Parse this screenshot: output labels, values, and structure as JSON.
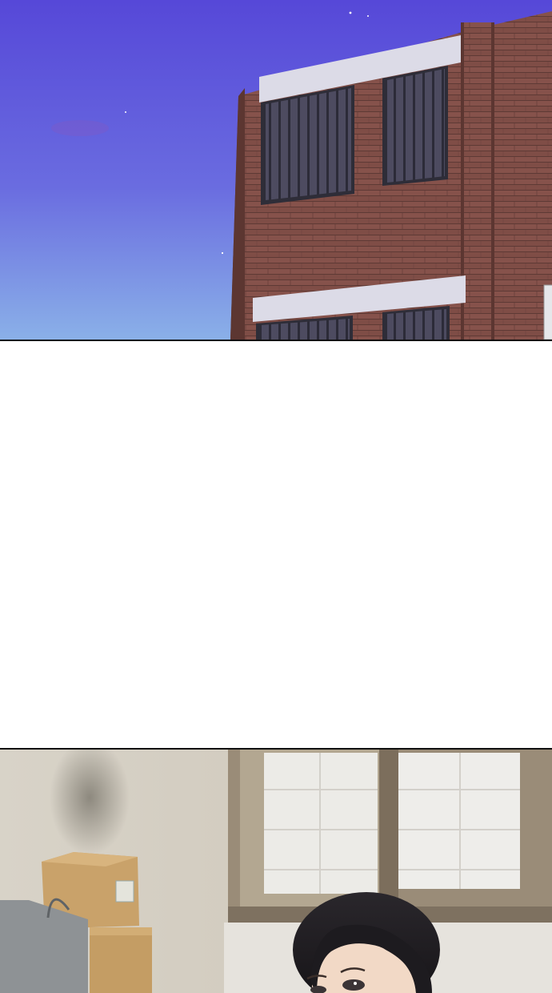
{
  "colors": {
    "sky_top": "#5a4fd6",
    "sky_mid": "#6a68e0",
    "sky_bottom": "#86a8e6",
    "brick": "#7a4a44",
    "brick_dark": "#5c3631",
    "window_glass": "#4a4a5c",
    "window_trim": "#d9d8e6",
    "interior_wall": "#ddd8cc",
    "interior_window_frame": "#8c7e6c",
    "box": "#c9a26a",
    "bag": "#8f9396",
    "hair": "#1d1b1f",
    "skin": "#f2d9c6"
  },
  "scenes": [
    {
      "name": "night-brick-building",
      "description": ""
    },
    {
      "name": "blank-gap"
    },
    {
      "name": "interior-room-with-character"
    }
  ]
}
